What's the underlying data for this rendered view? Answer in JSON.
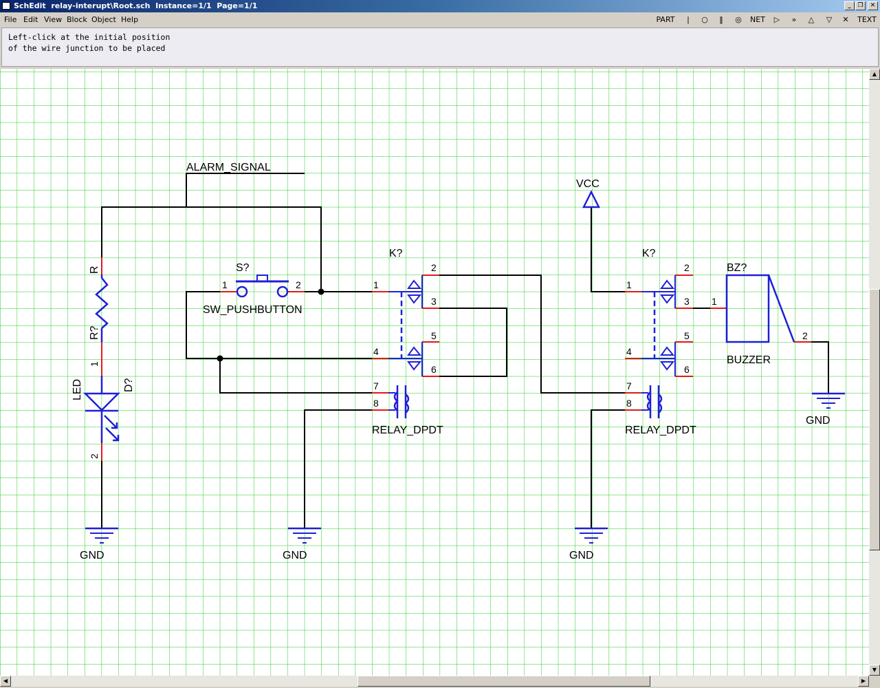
{
  "window": {
    "title": "SchEdit  relay-interupt\\Root.sch  Instance=1/1  Page=1/1"
  },
  "menu": [
    "File",
    "Edit",
    "View",
    "Block",
    "Object",
    "Help"
  ],
  "toolbar": {
    "part_label": "PART",
    "net_label": "NET",
    "text_label": "TEXT",
    "icons": [
      "wire-icon",
      "junction-icon",
      "bus-icon",
      "power-icon",
      "port-icon",
      "offpage-icon",
      "vcc-icon",
      "gnd-icon",
      "noconnect-icon"
    ]
  },
  "status_message": "Left-click at the initial position\nof the wire junction to be placed",
  "colors": {
    "grid": "#22cc22",
    "wire": "#000000",
    "symbol": "#1f1fd6",
    "pin": "#e01a1a"
  },
  "schematic": {
    "net_label": "ALARM_SIGNAL",
    "resistor": {
      "ref": "R?",
      "value": "R",
      "pin1": "1"
    },
    "led": {
      "ref": "D?",
      "value": "LED",
      "pin1": "1",
      "pin2": "2"
    },
    "switch": {
      "ref": "S?",
      "value": "SW_PUSHBUTTON",
      "pin1": "1",
      "pin2": "2"
    },
    "relay1": {
      "ref": "K?",
      "value": "RELAY_DPDT",
      "pins": [
        "1",
        "2",
        "3",
        "4",
        "5",
        "6",
        "7",
        "8"
      ]
    },
    "relay2": {
      "ref": "K?",
      "value": "RELAY_DPDT",
      "pins": [
        "1",
        "2",
        "3",
        "4",
        "5",
        "6",
        "7",
        "8"
      ]
    },
    "buzzer": {
      "ref": "BZ?",
      "value": "BUZZER",
      "pin1": "1",
      "pin2": "2"
    },
    "vcc": "VCC",
    "gnd": "GND"
  }
}
